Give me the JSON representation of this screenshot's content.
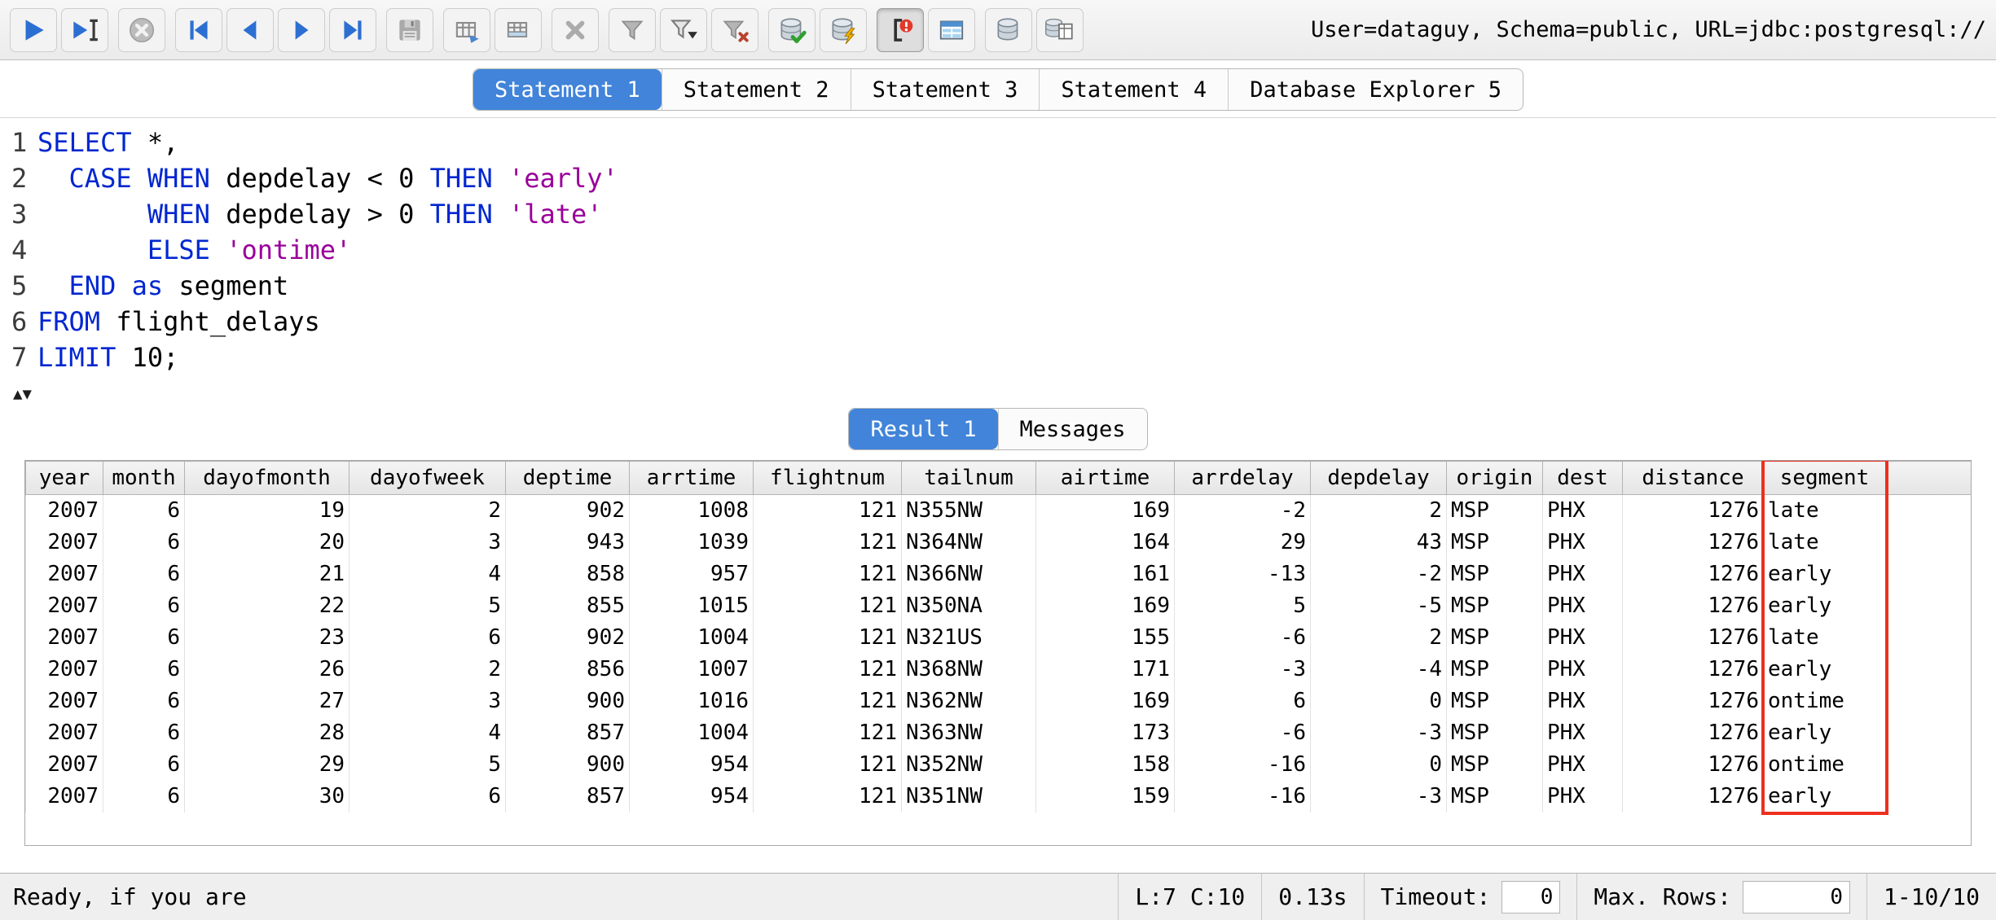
{
  "colors": {
    "active_tab_bg": "#4184d9",
    "keyword": "#0026d0",
    "string_literal": "#990099",
    "highlight_red": "#ee2f1f"
  },
  "toolbar": {
    "connection_info": "User=dataguy, Schema=public, URL=jdbc:postgresql://",
    "groups": [
      [
        {
          "name": "run",
          "icon": "play-icon",
          "enabled": true
        },
        {
          "name": "run-current",
          "icon": "play-to-cursor-icon",
          "enabled": true
        }
      ],
      [
        {
          "name": "stop",
          "icon": "stop-icon",
          "enabled": false
        }
      ],
      [
        {
          "name": "first-row",
          "icon": "first-icon",
          "enabled": true
        },
        {
          "name": "previous-row",
          "icon": "previous-icon",
          "enabled": true
        },
        {
          "name": "next-row",
          "icon": "next-icon",
          "enabled": true
        },
        {
          "name": "last-row",
          "icon": "last-icon",
          "enabled": true
        }
      ],
      [
        {
          "name": "save",
          "icon": "save-icon",
          "enabled": false
        }
      ],
      [
        {
          "name": "update-database",
          "icon": "update-database-icon",
          "enabled": false
        },
        {
          "name": "insert-row",
          "icon": "insert-row-icon",
          "enabled": false
        }
      ],
      [
        {
          "name": "delete-row",
          "icon": "delete-row-icon",
          "enabled": false
        }
      ],
      [
        {
          "name": "filter",
          "icon": "filter-icon",
          "enabled": false
        },
        {
          "name": "filter-dropdown",
          "icon": "filter-dropdown-icon",
          "enabled": true
        },
        {
          "name": "reset-filter",
          "icon": "reset-filter-icon",
          "enabled": false
        }
      ],
      [
        {
          "name": "commit",
          "icon": "commit-icon",
          "enabled": true
        },
        {
          "name": "rollback",
          "icon": "rollback-icon",
          "enabled": true
        }
      ],
      [
        {
          "name": "toggle-autocommit",
          "icon": "autocommit-icon",
          "enabled": true,
          "pressed": true
        },
        {
          "name": "data-pumper",
          "icon": "data-table-icon",
          "enabled": true
        }
      ],
      [
        {
          "name": "connection-db",
          "icon": "database-icon",
          "enabled": true
        },
        {
          "name": "database-explorer",
          "icon": "database-explorer-icon",
          "enabled": true
        }
      ]
    ]
  },
  "statement_tabs": {
    "active_index": 0,
    "items": [
      "Statement 1",
      "Statement 2",
      "Statement 3",
      "Statement 4",
      "Database Explorer 5"
    ]
  },
  "editor": {
    "lines": [
      {
        "number": "1",
        "tokens": [
          [
            "kw",
            "SELECT"
          ],
          [
            "pl",
            " *,"
          ]
        ]
      },
      {
        "number": "2",
        "tokens": [
          [
            "pl",
            "  "
          ],
          [
            "kw",
            "CASE"
          ],
          [
            "pl",
            " "
          ],
          [
            "kw",
            "WHEN"
          ],
          [
            "pl",
            " depdelay < 0 "
          ],
          [
            "kw",
            "THEN"
          ],
          [
            "pl",
            " "
          ],
          [
            "str",
            "'early'"
          ]
        ]
      },
      {
        "number": "3",
        "tokens": [
          [
            "pl",
            "       "
          ],
          [
            "kw",
            "WHEN"
          ],
          [
            "pl",
            " depdelay > 0 "
          ],
          [
            "kw",
            "THEN"
          ],
          [
            "pl",
            " "
          ],
          [
            "str",
            "'late'"
          ]
        ]
      },
      {
        "number": "4",
        "tokens": [
          [
            "pl",
            "       "
          ],
          [
            "kw",
            "ELSE"
          ],
          [
            "pl",
            " "
          ],
          [
            "str",
            "'ontime'"
          ]
        ]
      },
      {
        "number": "5",
        "tokens": [
          [
            "pl",
            "  "
          ],
          [
            "kw",
            "END"
          ],
          [
            "pl",
            " "
          ],
          [
            "kw",
            "as"
          ],
          [
            "pl",
            " segment"
          ]
        ]
      },
      {
        "number": "6",
        "tokens": [
          [
            "kw",
            "FROM"
          ],
          [
            "pl",
            " flight_delays"
          ]
        ]
      },
      {
        "number": "7",
        "tokens": [
          [
            "kw",
            "LIMIT"
          ],
          [
            "pl",
            " 10;"
          ]
        ]
      }
    ]
  },
  "splitter": {
    "up_glyph": "▲",
    "down_glyph": "▼"
  },
  "result_tabs": {
    "active_index": 0,
    "items": [
      "Result 1",
      "Messages"
    ]
  },
  "result_table": {
    "columns": [
      {
        "label": "year",
        "align": "right"
      },
      {
        "label": "month",
        "align": "right"
      },
      {
        "label": "dayofmonth",
        "align": "right"
      },
      {
        "label": "dayofweek",
        "align": "right"
      },
      {
        "label": "deptime",
        "align": "right"
      },
      {
        "label": "arrtime",
        "align": "right"
      },
      {
        "label": "flightnum",
        "align": "right"
      },
      {
        "label": "tailnum",
        "align": "left"
      },
      {
        "label": "airtime",
        "align": "right"
      },
      {
        "label": "arrdelay",
        "align": "right"
      },
      {
        "label": "depdelay",
        "align": "right"
      },
      {
        "label": "origin",
        "align": "left"
      },
      {
        "label": "dest",
        "align": "left"
      },
      {
        "label": "distance",
        "align": "right"
      },
      {
        "label": "segment",
        "align": "left",
        "highlighted": true
      }
    ],
    "rows": [
      [
        "2007",
        "6",
        "19",
        "2",
        "902",
        "1008",
        "121",
        "N355NW",
        "169",
        "-2",
        "2",
        "MSP",
        "PHX",
        "1276",
        "late"
      ],
      [
        "2007",
        "6",
        "20",
        "3",
        "943",
        "1039",
        "121",
        "N364NW",
        "164",
        "29",
        "43",
        "MSP",
        "PHX",
        "1276",
        "late"
      ],
      [
        "2007",
        "6",
        "21",
        "4",
        "858",
        "957",
        "121",
        "N366NW",
        "161",
        "-13",
        "-2",
        "MSP",
        "PHX",
        "1276",
        "early"
      ],
      [
        "2007",
        "6",
        "22",
        "5",
        "855",
        "1015",
        "121",
        "N350NA",
        "169",
        "5",
        "-5",
        "MSP",
        "PHX",
        "1276",
        "early"
      ],
      [
        "2007",
        "6",
        "23",
        "6",
        "902",
        "1004",
        "121",
        "N321US",
        "155",
        "-6",
        "2",
        "MSP",
        "PHX",
        "1276",
        "late"
      ],
      [
        "2007",
        "6",
        "26",
        "2",
        "856",
        "1007",
        "121",
        "N368NW",
        "171",
        "-3",
        "-4",
        "MSP",
        "PHX",
        "1276",
        "early"
      ],
      [
        "2007",
        "6",
        "27",
        "3",
        "900",
        "1016",
        "121",
        "N362NW",
        "169",
        "6",
        "0",
        "MSP",
        "PHX",
        "1276",
        "ontime"
      ],
      [
        "2007",
        "6",
        "28",
        "4",
        "857",
        "1004",
        "121",
        "N363NW",
        "173",
        "-6",
        "-3",
        "MSP",
        "PHX",
        "1276",
        "early"
      ],
      [
        "2007",
        "6",
        "29",
        "5",
        "900",
        "954",
        "121",
        "N352NW",
        "158",
        "-16",
        "0",
        "MSP",
        "PHX",
        "1276",
        "ontime"
      ],
      [
        "2007",
        "6",
        "30",
        "6",
        "857",
        "954",
        "121",
        "N351NW",
        "159",
        "-16",
        "-3",
        "MSP",
        "PHX",
        "1276",
        "early"
      ]
    ],
    "highlight_color": "#ee2f1f"
  },
  "status_bar": {
    "message": "Ready, if you are",
    "cursor_position": "L:7 C:10",
    "exec_time": "0.13s",
    "timeout_label": "Timeout:",
    "timeout_value": "0",
    "max_rows_label": "Max. Rows:",
    "max_rows_value": "0",
    "row_range": "1-10/10"
  }
}
